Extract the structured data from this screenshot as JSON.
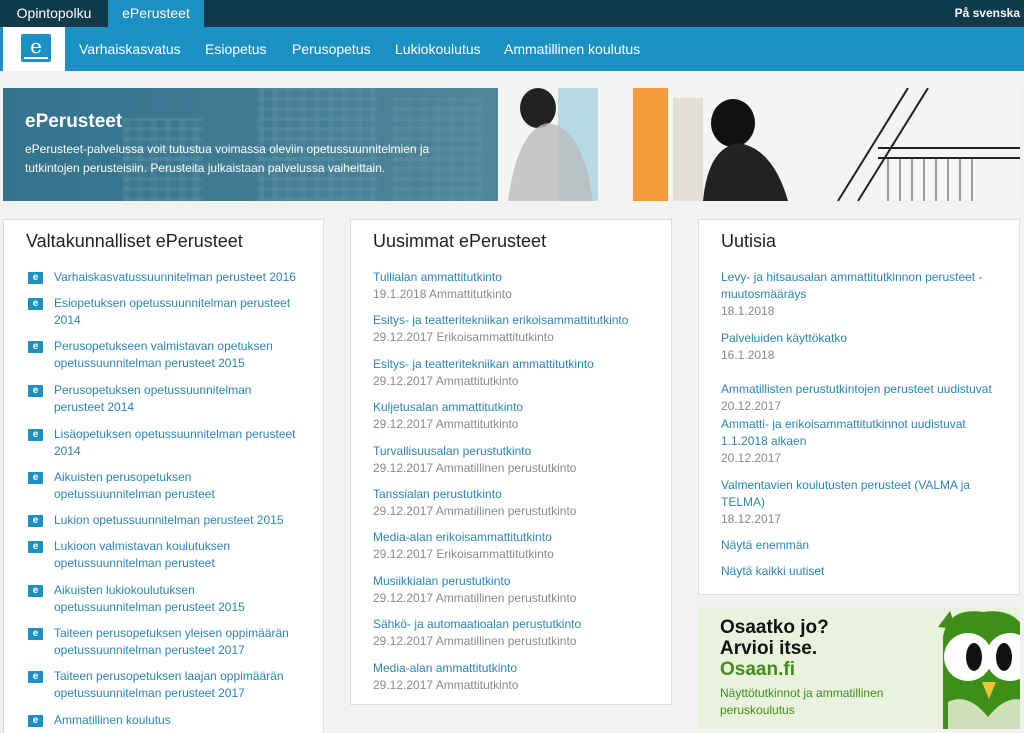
{
  "topbar": {
    "tabs": [
      "Opintopolku",
      "ePerusteet"
    ],
    "language_link": "På svenska"
  },
  "navbar": {
    "logo_letter": "e",
    "items": [
      "Varhaiskasvatus",
      "Esiopetus",
      "Perusopetus",
      "Lukiokoulutus",
      "Ammatillinen koulutus"
    ]
  },
  "hero": {
    "title": "ePerusteet",
    "text_line1": "ePerusteet-palvelussa voit tutustua voimassa oleviin opetussuunnitelmien ja",
    "text_line2": "tutkintojen perusteisiin. Perusteita julkaistaan palvelussa vaiheittain."
  },
  "national": {
    "heading": "Valtakunnalliset ePerusteet",
    "icon_letter": "e",
    "items": [
      [
        "Varhaiskasvatussuunnitelman perusteet 2016"
      ],
      [
        "Esiopetuksen opetussuunnitelman perusteet",
        "2014"
      ],
      [
        "Perusopetukseen valmistavan opetuksen",
        "opetussuunnitelman perusteet 2015"
      ],
      [
        "Perusopetuksen opetussuunnitelman",
        "perusteet 2014"
      ],
      [
        "Lisäopetuksen opetussuunnitelman perusteet",
        "2014"
      ],
      [
        "Aikuisten perusopetuksen",
        "opetussuunnitelman perusteet"
      ],
      [
        "Lukion opetussuunnitelman perusteet 2015"
      ],
      [
        "Lukioon valmistavan koulutuksen",
        "opetussuunnitelman perusteet"
      ],
      [
        "Aikuisten lukiokoulutuksen",
        "opetussuunnitelman perusteet 2015"
      ],
      [
        "Taiteen perusopetuksen yleisen oppimäärän",
        "opetussuunnitelman perusteet 2017"
      ],
      [
        "Taiteen perusopetuksen laajan oppimäärän",
        "opetussuunnitelman perusteet 2017"
      ],
      [
        "Ammatillinen koulutus"
      ]
    ]
  },
  "newest": {
    "heading": "Uusimmat ePerusteet",
    "items": [
      {
        "title": "Tullialan ammattitutkinto",
        "meta": "19.1.2018 Ammattitutkinto"
      },
      {
        "title": "Esitys- ja teatteritekniikan erikoisammattitutkinto",
        "meta": "29.12.2017 Erikoisammattitutkinto"
      },
      {
        "title": "Esitys- ja teatteritekniikan ammattitutkinto",
        "meta": "29.12.2017 Ammattitutkinto"
      },
      {
        "title": "Kuljetusalan ammattitutkinto",
        "meta": "29.12.2017 Ammattitutkinto"
      },
      {
        "title": "Turvallisuusalan perustutkinto",
        "meta": "29.12.2017 Ammatillinen perustutkinto"
      },
      {
        "title": "Tanssialan perustutkinto",
        "meta": "29.12.2017 Ammatillinen perustutkinto"
      },
      {
        "title": "Media-alan erikoisammattitutkinto",
        "meta": "29.12.2017 Erikoisammattitutkinto"
      },
      {
        "title": "Musiikkialan perustutkinto",
        "meta": "29.12.2017 Ammatillinen perustutkinto"
      },
      {
        "title": "Sähkö- ja automaatioalan perustutkinto",
        "meta": "29.12.2017 Ammatillinen perustutkinto"
      },
      {
        "title": "Media-alan ammattitutkinto",
        "meta": "29.12.2017 Ammattitutkinto"
      }
    ]
  },
  "news": {
    "heading": "Uutisia",
    "items": [
      {
        "title": [
          "Levy- ja hitsausalan ammattitutkinnon perusteet -",
          "muutosmääräys"
        ],
        "date": "18.1.2018"
      },
      {
        "title": [
          "Palveluiden käyttökatko"
        ],
        "date": "16.1.2018"
      },
      {
        "title": [
          "Ammatillisten perustutkintojen perusteet uudistuvat"
        ],
        "date": "20.12.2017"
      },
      {
        "title": [
          "Ammatti- ja erikoisammattitutkinnot uudistuvat",
          "1.1.2018 alkaen"
        ],
        "date": "20.12.2017"
      },
      {
        "title": [
          "Valmentavien koulutusten perusteet (VALMA ja",
          "TELMA)"
        ],
        "date": "18.12.2017"
      }
    ],
    "show_more": "Näytä enemmän",
    "show_all": "Näytä kaikki uutiset"
  },
  "osaan": {
    "line1": "Osaatko jo?",
    "line2": "Arvioi itse.",
    "line3": "Osaan.fi",
    "sub_line1": "Näyttötutkinnot ja ammatillinen",
    "sub_line2": "peruskoulutus"
  },
  "colors": {
    "brand_blue": "#1b91c3",
    "top_dark": "#0e3a4a",
    "link": "#2a85b8",
    "osaan_green": "#3e8f1a"
  }
}
